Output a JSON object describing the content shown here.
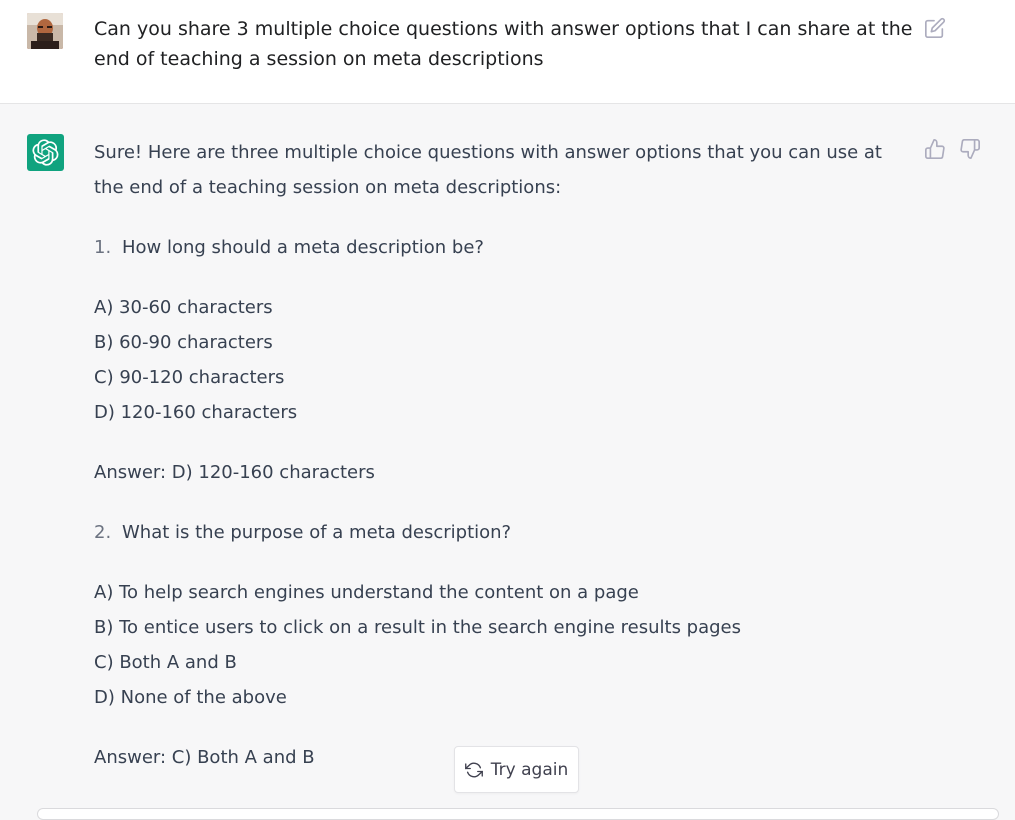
{
  "user_message": {
    "text": "Can you share 3 multiple choice questions with answer options that I can share at the end of teaching a session on meta descriptions",
    "avatar_icon": "user-avatar",
    "edit_icon": "edit-icon"
  },
  "assistant_message": {
    "intro": "Sure! Here are three multiple choice questions with answer options that you can use at the end of a teaching session on meta descriptions:",
    "questions": [
      {
        "number": "1.",
        "question": "How long should a meta description be?",
        "options": [
          "A) 30-60 characters",
          "B) 60-90 characters",
          "C) 90-120 characters",
          "D) 120-160 characters"
        ],
        "answer": "Answer: D) 120-160 characters"
      },
      {
        "number": "2.",
        "question": "What is the purpose of a meta description?",
        "options": [
          "A) To help search engines understand the content on a page",
          "B) To entice users to click on a result in the search engine results pages",
          "C) Both A and B",
          "D) None of the above"
        ],
        "answer": "Answer: C) Both A and B"
      }
    ]
  },
  "actions": {
    "try_again_label": "Try again"
  },
  "colors": {
    "brand_green": "#10a37f",
    "assistant_bg": "#f7f7f8",
    "user_bg": "#ffffff"
  }
}
